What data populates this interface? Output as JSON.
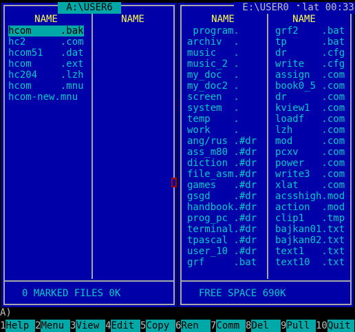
{
  "left_panel": {
    "path": " A:\\USER6 ",
    "col1_header": "NAME",
    "col2_header": "NAME",
    "files": [
      "hcom     .bak",
      "hc2      .com",
      "hcom51   .dat",
      "hcom     .ext",
      "hc204    .lzh",
      "hcom     .mnu",
      "hcom-new.mnu"
    ],
    "status": "0 MARKED FILES 0K"
  },
  "right_panel": {
    "path": " E:\\USER0 ",
    "clock": "lat 00:33",
    "col1_header": "NAME",
    "col2_header": "NAME",
    "col1_files": [
      " program.",
      "archiv  .",
      "music   .",
      "music_2 .",
      "my_doc  .",
      "my_doc2 .",
      "screen  .",
      "system  .",
      "temp    .",
      "work    .",
      "ang/rus .#dr",
      "ass_m80 .#dr",
      "diction .#dr",
      "file_asm.#dr",
      "games   .#dr",
      "gsgd    .#dr",
      "handbook.#dr",
      "prog_pc .#dr",
      "terminal.#dr",
      "tpascal .#dr",
      "user_10 .#dr",
      "grf     .bat"
    ],
    "col2_files": [
      "grf2    .bat",
      "tp      .bat",
      "dr      .cfg",
      "write   .cfg",
      "assign  .com",
      "book0_5 .com",
      "dr      .com",
      "kview1  .com",
      "loadf   .com",
      "lzh     .com",
      "mod     .com",
      "pcxv    .com",
      "power   .com",
      "write3  .com",
      "xlat    .com",
      "acsshigh.mod",
      "action  .mod",
      "clip1   .tmp",
      "bajkan01.txt",
      "bajkan02.txt",
      "text1   .txt",
      "text10  .txt"
    ],
    "status": "FREE SPACE 690K"
  },
  "command_line": "A)",
  "function_keys": [
    {
      "num": "1",
      "label": "Help"
    },
    {
      "num": "2",
      "label": "Menu"
    },
    {
      "num": "3",
      "label": "View"
    },
    {
      "num": "4",
      "label": "Edit"
    },
    {
      "num": "5",
      "label": "Copy"
    },
    {
      "num": "6",
      "label": "Ren "
    },
    {
      "num": "7",
      "label": "Comm"
    },
    {
      "num": "8",
      "label": "Del "
    },
    {
      "num": "9",
      "label": "Pull"
    },
    {
      "num": "10",
      "label": "Quit"
    }
  ]
}
